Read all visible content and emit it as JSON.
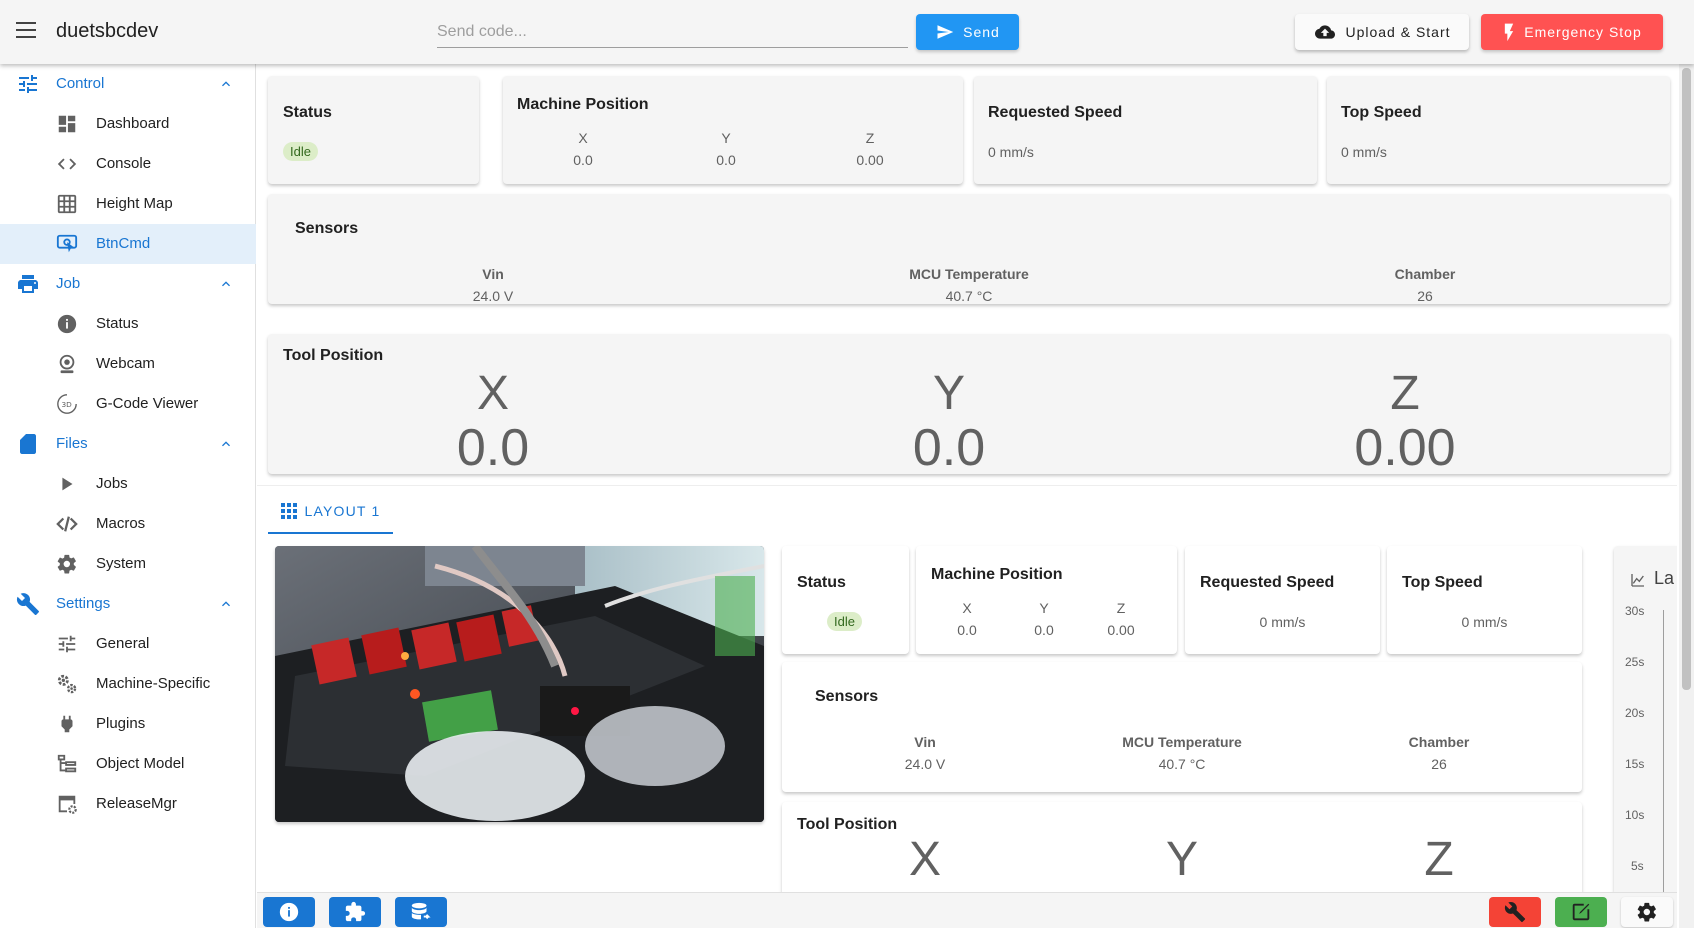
{
  "appbar": {
    "title": "duetsbcdev",
    "code_placeholder": "Send code...",
    "send_label": "Send",
    "upload_label": "Upload & Start",
    "estop_label": "Emergency Stop"
  },
  "sidebar": {
    "groups": [
      {
        "label": "Control",
        "items": [
          "Dashboard",
          "Console",
          "Height Map",
          "BtnCmd"
        ]
      },
      {
        "label": "Job",
        "items": [
          "Status",
          "Webcam",
          "G-Code Viewer"
        ]
      },
      {
        "label": "Files",
        "items": [
          "Jobs",
          "Macros",
          "System"
        ]
      },
      {
        "label": "Settings",
        "items": [
          "General",
          "Machine-Specific",
          "Plugins",
          "Object Model",
          "ReleaseMgr"
        ]
      }
    ],
    "active_item": "BtnCmd"
  },
  "upper": {
    "status": {
      "title": "Status",
      "value": "Idle"
    },
    "machine_position": {
      "title": "Machine Position",
      "axes": [
        {
          "label": "X",
          "value": "0.0"
        },
        {
          "label": "Y",
          "value": "0.0"
        },
        {
          "label": "Z",
          "value": "0.00"
        }
      ]
    },
    "requested_speed": {
      "title": "Requested Speed",
      "value": "0 mm/s"
    },
    "top_speed": {
      "title": "Top Speed",
      "value": "0 mm/s"
    },
    "sensors": {
      "title": "Sensors",
      "items": [
        {
          "label": "Vin",
          "value": "24.0 V"
        },
        {
          "label": "MCU Temperature",
          "value": "40.7 °C"
        },
        {
          "label": "Chamber",
          "value": "26"
        }
      ]
    },
    "tool_position": {
      "title": "Tool Position",
      "axes": [
        {
          "label": "X",
          "value": "0.0"
        },
        {
          "label": "Y",
          "value": "0.0"
        },
        {
          "label": "Z",
          "value": "0.00"
        }
      ]
    }
  },
  "tab": {
    "label": "LAYOUT 1"
  },
  "lower": {
    "status": {
      "title": "Status",
      "value": "Idle"
    },
    "machine_position": {
      "title": "Machine Position",
      "axes": [
        {
          "label": "X",
          "value": "0.0"
        },
        {
          "label": "Y",
          "value": "0.0"
        },
        {
          "label": "Z",
          "value": "0.00"
        }
      ]
    },
    "requested_speed": {
      "title": "Requested Speed",
      "value": "0 mm/s"
    },
    "top_speed": {
      "title": "Top Speed",
      "value": "0 mm/s"
    },
    "sensors": {
      "title": "Sensors",
      "items": [
        {
          "label": "Vin",
          "value": "24.0 V"
        },
        {
          "label": "MCU Temperature",
          "value": "40.7 °C"
        },
        {
          "label": "Chamber",
          "value": "26"
        }
      ]
    },
    "tool_position": {
      "title": "Tool Position",
      "axes": [
        {
          "label": "X"
        },
        {
          "label": "Y"
        },
        {
          "label": "Z"
        }
      ]
    },
    "chart": {
      "title_partial": "La",
      "y_ticks": [
        "30s",
        "25s",
        "20s",
        "15s",
        "10s",
        "5s"
      ]
    }
  },
  "colors": {
    "primary": "#1976d2",
    "send": "#2196f3",
    "estop": "#ff5252",
    "idle_chip": "#dcedc8",
    "bottom_info": "#1976d2",
    "bottom_wrench": "#f44336",
    "bottom_edit": "#4caf50"
  },
  "icons": {
    "bottom_left": [
      "info-icon",
      "puzzle-edit-icon",
      "database-export-icon"
    ],
    "bottom_right": [
      "wrench-icon",
      "edit-icon",
      "gear-icon"
    ]
  }
}
